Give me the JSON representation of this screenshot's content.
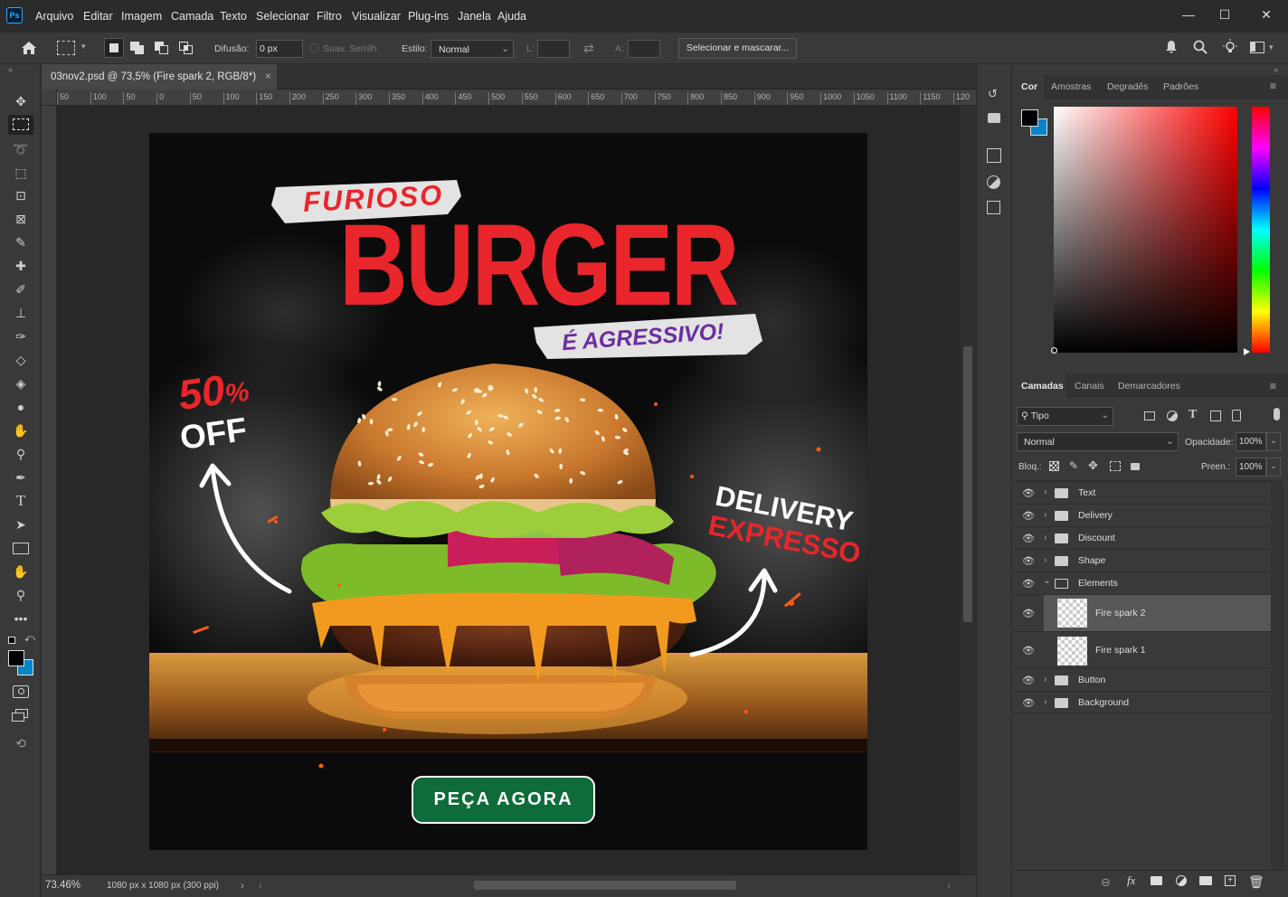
{
  "app": {
    "logo": "Ps"
  },
  "menu": [
    "Arquivo",
    "Editar",
    "Imagem",
    "Camada",
    "Texto",
    "Selecionar",
    "Filtro",
    "Visualizar",
    "Plug-ins",
    "Janela",
    "Ajuda"
  ],
  "window_controls": {
    "minimize": "—",
    "maximize": "☐",
    "close": "✕"
  },
  "options": {
    "feather_label": "Difusão:",
    "feather_value": "0 px",
    "antialias_label": "Suav. Serrilh.",
    "style_label": "Estilo:",
    "style_value": "Normal",
    "width_label": "L:",
    "height_label": "A:",
    "select_mask_label": "Selecionar e mascarar..."
  },
  "document": {
    "tab_title": "03nov2.psd @ 73,5% (Fire spark 2, RGB/8*)",
    "close_glyph": "×",
    "zoom": "73.46%",
    "doc_info": "1080 px x 1080 px (300 ppi)"
  },
  "ruler": [
    "50",
    "100",
    "50",
    "0",
    "50",
    "100",
    "150",
    "200",
    "250",
    "300",
    "350",
    "400",
    "450",
    "500",
    "550",
    "600",
    "650",
    "700",
    "750",
    "800",
    "850",
    "900",
    "950",
    "1000",
    "1050",
    "1100",
    "1150",
    "120"
  ],
  "artwork": {
    "furioso": "FURIOSO",
    "burger": "BURGER",
    "agressivo": "É AGRESSIVO!",
    "discount_number": "50",
    "discount_percent": "%",
    "discount_off": "OFF",
    "delivery": "DELIVERY",
    "expresso": "EXPRESSO",
    "cta": "PEÇA AGORA"
  },
  "color_panel": {
    "tabs": [
      "Cor",
      "Amostras",
      "Degradês",
      "Padrões"
    ],
    "foreground": "#000000",
    "background": "#0a84c8",
    "hue": "#ff0000"
  },
  "layers_panel": {
    "tabs": [
      "Camadas",
      "Canais",
      "Demarcadores"
    ],
    "filter_label": "Tipo",
    "blend_mode": "Normal",
    "opacity_label": "Opacidade:",
    "opacity_value": "100%",
    "lock_label": "Bloq.:",
    "fill_label": "Preen.:",
    "fill_value": "100%",
    "layers": [
      {
        "name": "Text",
        "type": "group"
      },
      {
        "name": "Delivery",
        "type": "group"
      },
      {
        "name": "Discount",
        "type": "group"
      },
      {
        "name": "Shape",
        "type": "group"
      },
      {
        "name": "Elements",
        "type": "group-open"
      },
      {
        "name": "Fire spark 2",
        "type": "layer",
        "selected": true
      },
      {
        "name": "Fire spark 1",
        "type": "layer"
      },
      {
        "name": "Button",
        "type": "group"
      },
      {
        "name": "Background",
        "type": "group"
      }
    ]
  },
  "colors": {
    "accent_red": "#e8262b",
    "cta_green": "#0e6b3a",
    "purple": "#6b2fa0"
  }
}
